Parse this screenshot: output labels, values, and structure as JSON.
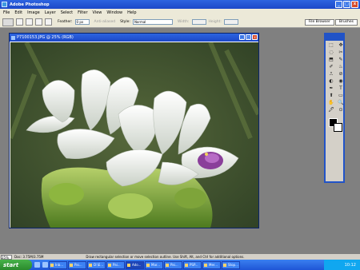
{
  "app": {
    "title": "Adobe Photoshop",
    "window_buttons": [
      "_",
      "□",
      "x"
    ]
  },
  "menu": [
    "File",
    "Edit",
    "Image",
    "Layer",
    "Select",
    "Filter",
    "View",
    "Window",
    "Help"
  ],
  "options": {
    "feather_label": "Feather:",
    "feather_value": "0 px",
    "anti_alias_label": "Anti-aliased",
    "style_label": "Style:",
    "style_value": "Normal",
    "width_label": "Width:",
    "height_label": "Height:"
  },
  "tabs": [
    "File Browser",
    "Brushes"
  ],
  "document": {
    "title": "P7100153.JPG @ 25% (RGB)"
  },
  "toolbox": {
    "tools": [
      "⬚",
      "✥",
      "◌",
      "✂",
      "⬒",
      "✎",
      "✐",
      "♨",
      "⎍",
      "⊘",
      "◐",
      "◉",
      "✒",
      "T",
      "⬆",
      "▭",
      "✋",
      "🔍",
      "🖋",
      "⊙"
    ],
    "colors": {
      "foreground": "#000000",
      "background": "#ffffff"
    }
  },
  "status": {
    "zoom": "25%",
    "doc_size": "Doc: 3.75M/3.75M",
    "hint": "Draw rectangular selection or move selection outline. Use Shift, Alt, and Ctrl for additional options."
  },
  "taskbar": {
    "start": "start",
    "tasks": [
      "Inb...",
      "Pai...",
      "D:\\E...",
      "Pai...",
      "Ado...",
      "Mar...",
      "Pai...",
      "PSP...",
      "Mer...",
      "Stop..."
    ],
    "clock": "10:12"
  }
}
